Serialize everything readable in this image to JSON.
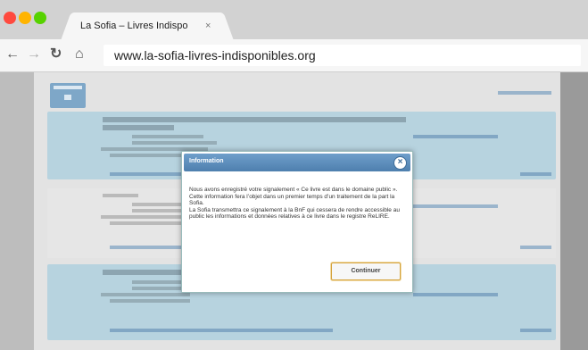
{
  "browser": {
    "tab_title": "La Sofia – Livres Indispo",
    "tab_close": "×",
    "url": "www.la-sofia-livres-indisponibles.org",
    "icons": {
      "back": "←",
      "forward": "→",
      "reload": "↻",
      "home": "⌂"
    }
  },
  "modal": {
    "title": "Information",
    "close": "×",
    "body": [
      "Nous avons enregistré votre signalement « Ce livre est dans le domaine public ».",
      "Cette information fera l’objet dans un premier temps d’un traitement de la part la Sofia.",
      "La Sofia transmettra ce signalement à la BnF qui cessera de rendre accessible au public les informations et données relatives à ce livre dans le registre ReLIRE."
    ],
    "button_label": "Continuer"
  }
}
